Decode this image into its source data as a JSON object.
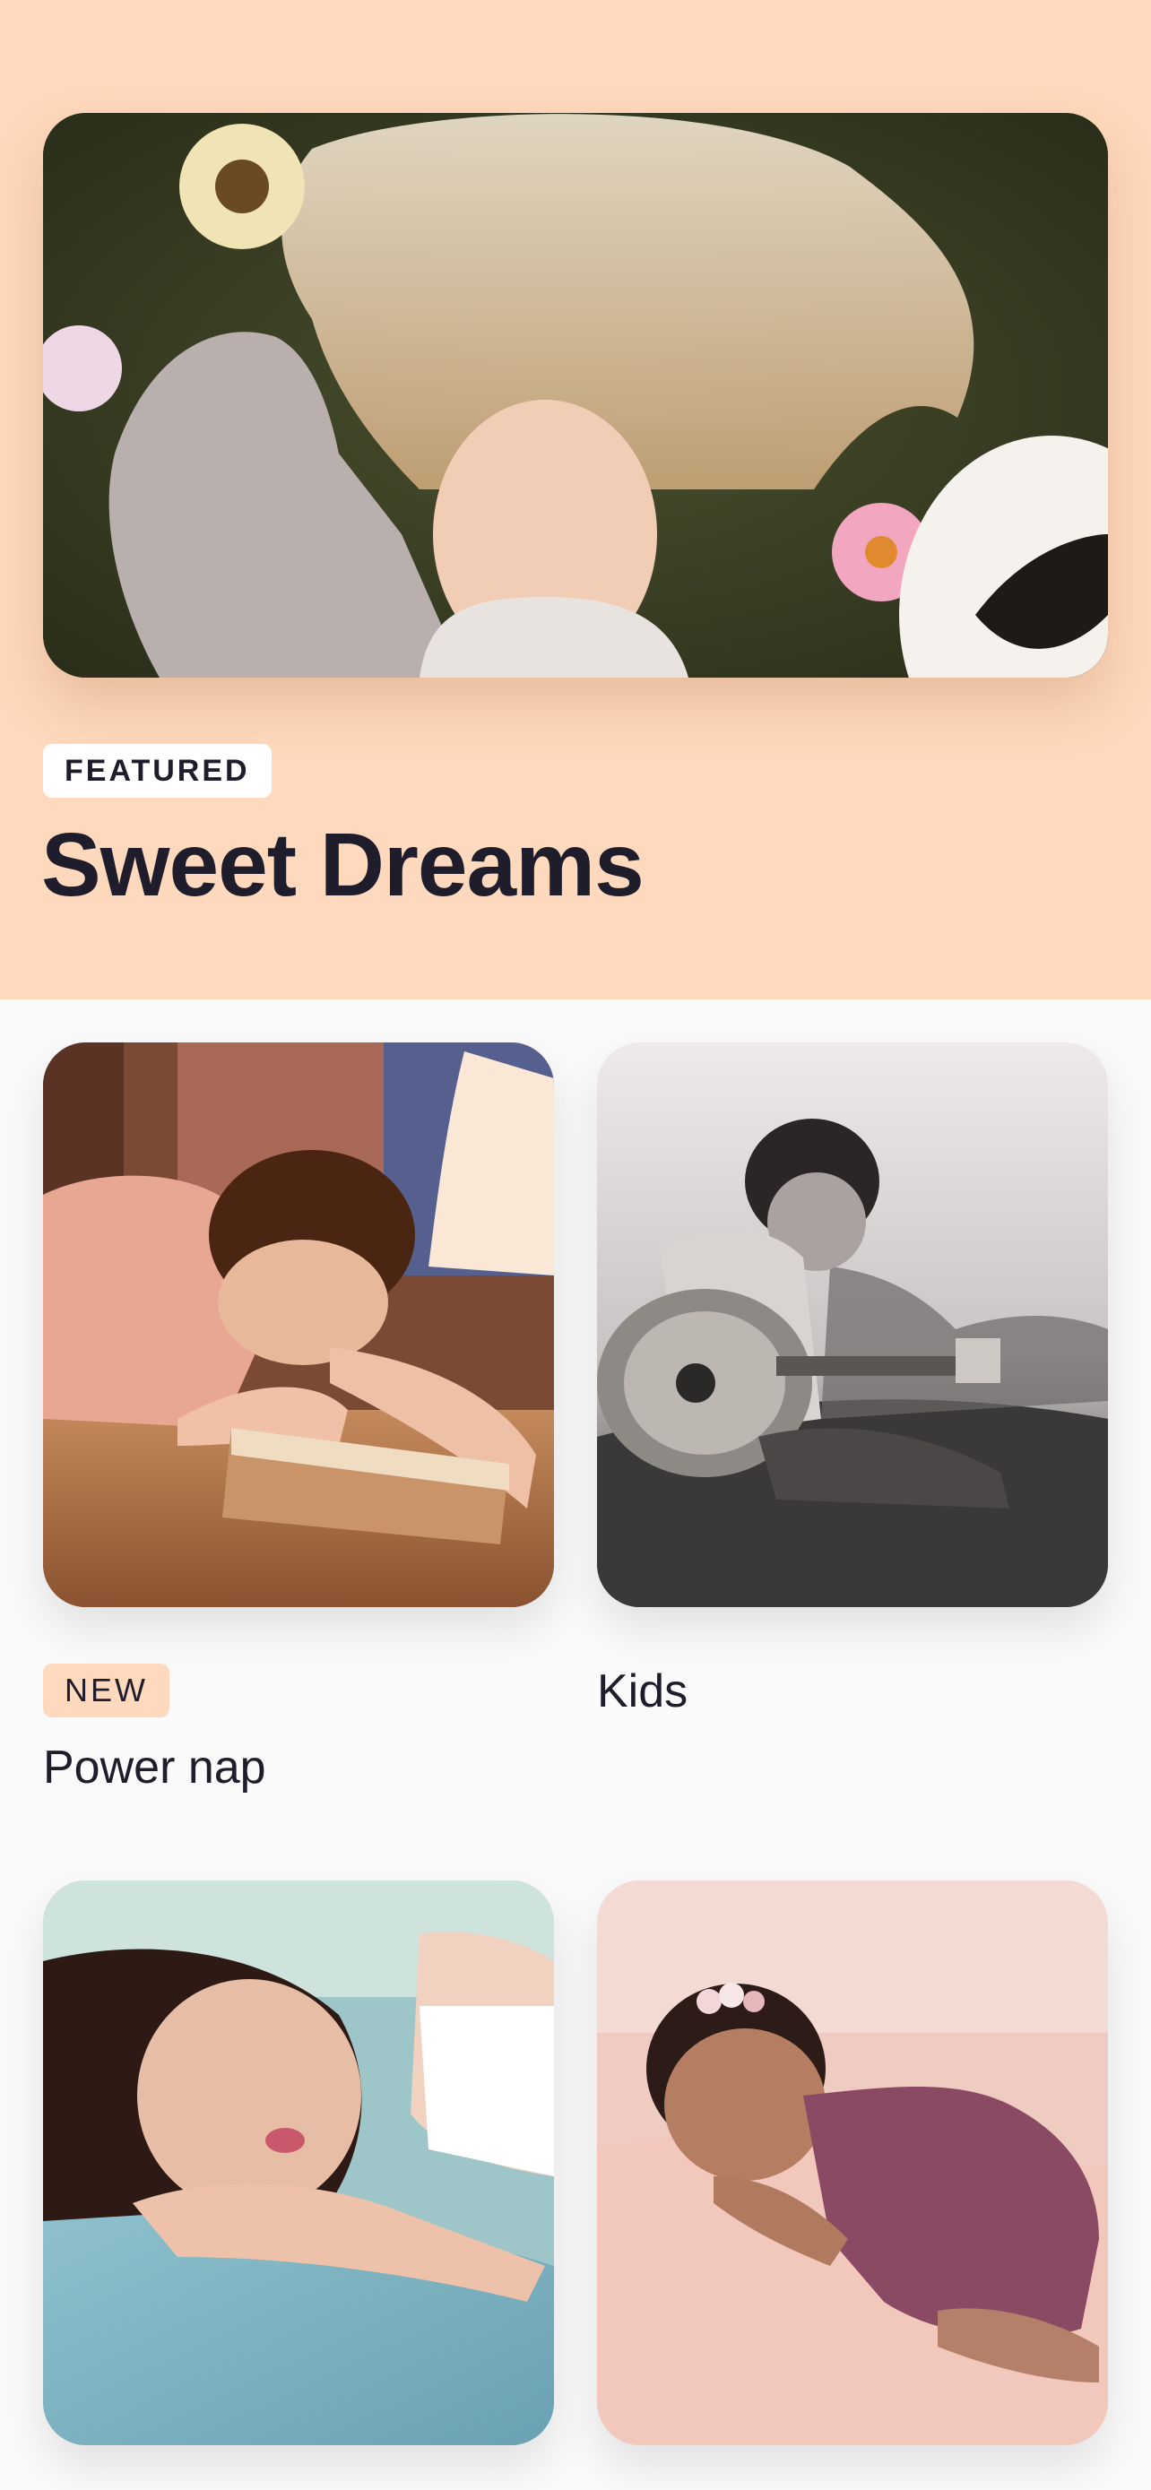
{
  "featured": {
    "badge": "FEATURED",
    "title": "Sweet Dreams",
    "image": "woman-lying-in-grass-with-flowers"
  },
  "grid": [
    {
      "badge": "NEW",
      "title": "Power nap",
      "image": "woman-sleeping-on-table-beside-lamp"
    },
    {
      "badge": "",
      "title": "Kids",
      "image": "boy-playing-guitar-black-and-white"
    },
    {
      "badge": "",
      "title": "",
      "image": "woman-sleeping-on-blue-pillow"
    },
    {
      "badge": "",
      "title": "",
      "image": "sleeping-baby-with-flower-headband"
    }
  ],
  "colors": {
    "hero_background": "#FFD9BD",
    "page_background": "#FAFAFA",
    "text": "#1F1D2B",
    "new_badge": "#FFD9BD"
  }
}
